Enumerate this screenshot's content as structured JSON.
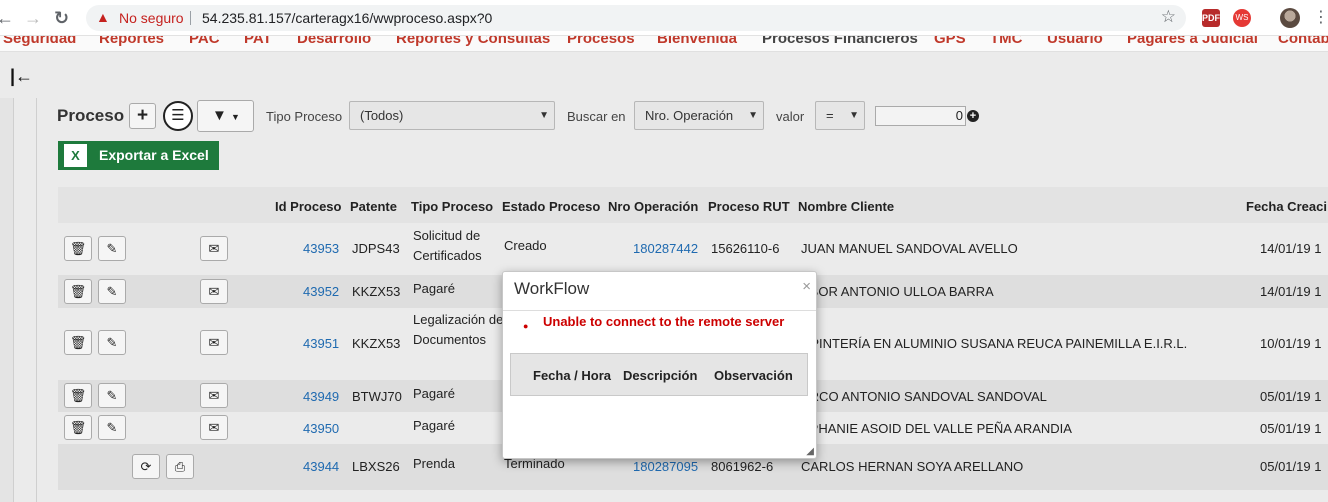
{
  "browser": {
    "back": "←",
    "forward": "→",
    "reload": "↻",
    "security_label": "No seguro",
    "url": "54.235.81.157/carteragx16/wwproceso.aspx?0",
    "icons": [
      "alert-triangle-icon",
      "star-icon",
      "pdf-extension-icon",
      "extension-icon",
      "profile-avatar",
      "kebab-menu-icon"
    ],
    "ext_pdf": "PDF",
    "ext_ws": "WS",
    "menu_dots": "⋮",
    "star": "☆"
  },
  "menu": [
    "Seguridad",
    "Reportes",
    "PAC",
    "PAT",
    "Desarrollo",
    "Reportes y Consultas",
    "Procesos",
    "Bienvenida",
    "Procesos Financieros",
    "GPS",
    "TMC",
    "Usuario",
    "Pagares a Judicial",
    "Contab"
  ],
  "toolbar": {
    "title": "Proceso",
    "add": "+",
    "filter_icon": "▼",
    "tipo_proceso_label": "Tipo Proceso",
    "tipo_proceso_value": "(Todos)",
    "buscar_en_label": "Buscar en",
    "buscar_en_value": "Nro. Operación",
    "valor_label": "valor",
    "operator_value": "=",
    "valor_input": "0",
    "excel_label": "Exportar a Excel",
    "excel_icon_text": "X"
  },
  "table": {
    "headers": [
      "Id Proceso",
      "Patente",
      "Tipo Proceso",
      "Estado Proceso",
      "Nro Operación",
      "Proceso RUT",
      "Nombre Cliente",
      "Fecha Creaci"
    ],
    "rows": [
      {
        "id": "43953",
        "patente": "JDPS43",
        "tipo": "Solicitud de Certificados",
        "estado": "Creado",
        "nro": "180287442",
        "rut": "15626110-6",
        "cliente": "JUAN MANUEL SANDOVAL AVELLO",
        "fecha": "14/01/19 1"
      },
      {
        "id": "43952",
        "patente": "KKZX53",
        "tipo": "Pagaré",
        "estado": "",
        "nro": "",
        "rut": "",
        "cliente": "ABOR ANTONIO ULLOA BARRA",
        "fecha": "14/01/19 1"
      },
      {
        "id": "43951",
        "patente": "KKZX53",
        "tipo": "Legalización de Documentos",
        "estado": "",
        "nro": "",
        "rut": "",
        "cliente": "RPINTERÍA EN ALUMINIO SUSANA REUCA PAINEMILLA E.I.R.L.",
        "fecha": "10/01/19 1"
      },
      {
        "id": "43949",
        "patente": "BTWJ70",
        "tipo": "Pagaré",
        "estado": "",
        "nro": "",
        "rut": "",
        "cliente": "ARCO ANTONIO SANDOVAL SANDOVAL",
        "fecha": "05/01/19 1"
      },
      {
        "id": "43950",
        "patente": "",
        "tipo": "Pagaré",
        "estado": "",
        "nro": "",
        "rut": "",
        "cliente": "EPHANIE ASOID DEL VALLE PEÑA ARANDIA",
        "fecha": "05/01/19 1"
      },
      {
        "id": "43944",
        "patente": "LBXS26",
        "tipo": "Prenda",
        "estado": "Terminado",
        "nro": "180287095",
        "rut": "8061962-6",
        "cliente": "CARLOS HERNAN SOYA ARELLANO",
        "fecha": "05/01/19 1"
      }
    ]
  },
  "modal": {
    "title": "WorkFlow",
    "close": "×",
    "error": "Unable to connect to the remote server",
    "columns": [
      "Fecha / Hora",
      "Descripción",
      "Observación"
    ]
  },
  "glyphs": {
    "delete": "🗑",
    "edit": "✎",
    "mail": "✉",
    "refresh": "⟳",
    "doc": "⎙",
    "collapse": "|←",
    "columns": "☰"
  }
}
